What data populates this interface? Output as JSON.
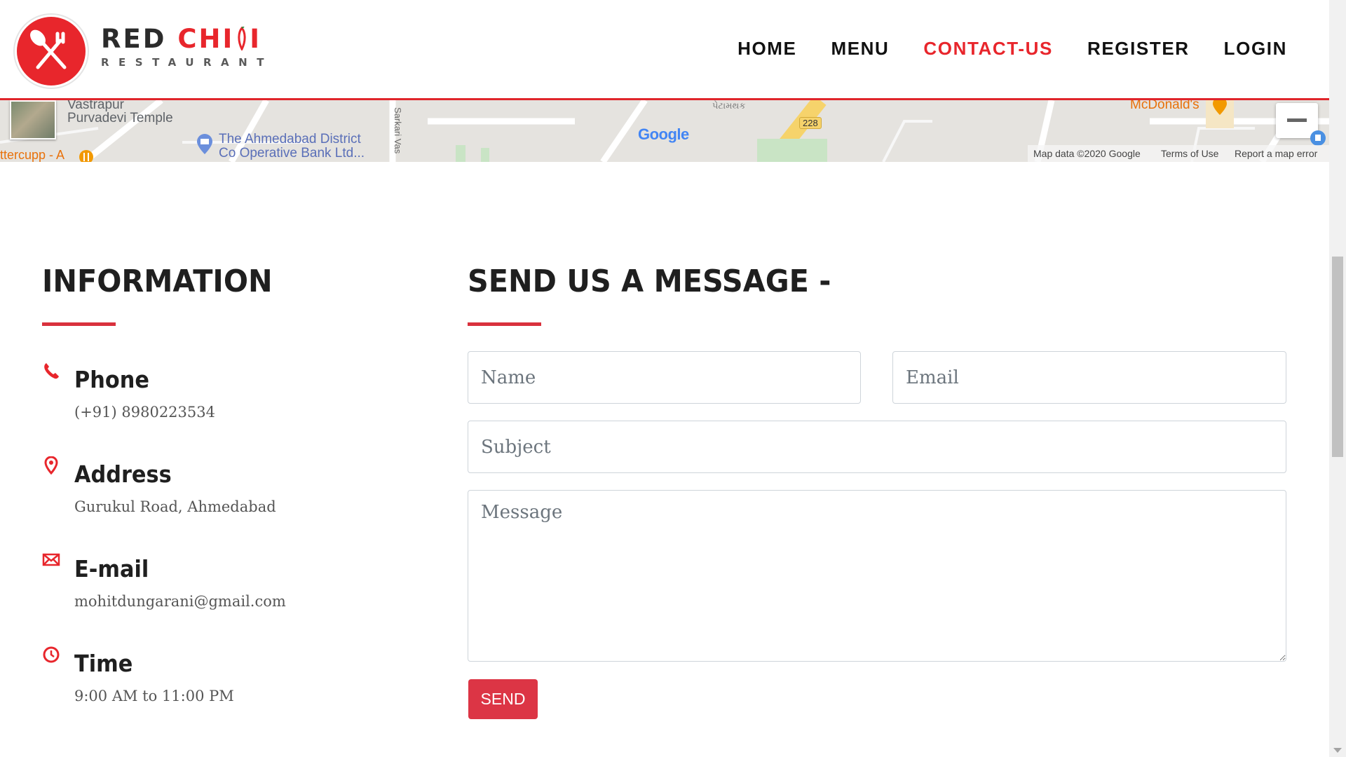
{
  "header": {
    "logo_word1": "RED ",
    "logo_word2": "CHI",
    "logo_word3": "I",
    "logo_sub": "RESTAURANT",
    "nav": [
      "HOME",
      "MENU",
      "CONTACT-US",
      "REGISTER",
      "LOGIN"
    ],
    "active_nav": "CONTACT-US"
  },
  "map": {
    "labels": {
      "vastrapur": "Vastrapur",
      "temple": "Purvadevi Temple",
      "bank_line1": "The Ahmedabad District",
      "bank_line2": "Co Operative Bank Ltd...",
      "buttercupp": "ttercupp - A",
      "mcdonalds": "McDonald's",
      "road_number": "228",
      "sarkari": "Sarkari Vas",
      "gujarati": "પેટામથક",
      "google": "Google"
    },
    "attribution": {
      "map_data": "Map data ©2020 Google",
      "terms": "Terms of Use",
      "report": "Report a map error"
    }
  },
  "information": {
    "title": "INFORMATION",
    "items": [
      {
        "icon": "phone-icon",
        "label": "Phone",
        "value": "(+91) 8980223534"
      },
      {
        "icon": "location-pin-icon",
        "label": "Address",
        "value": "Gurukul Road, Ahmedabad"
      },
      {
        "icon": "envelope-icon",
        "label": "E-mail",
        "value": "mohitdungarani@gmail.com"
      },
      {
        "icon": "clock-icon",
        "label": "Time",
        "value": "9:00 AM to 11:00 PM"
      }
    ]
  },
  "contact_form": {
    "title": "SEND US A MESSAGE -",
    "name_placeholder": "Name",
    "email_placeholder": "Email",
    "subject_placeholder": "Subject",
    "message_placeholder": "Message",
    "send_label": "SEND"
  },
  "colors": {
    "brand_red": "#e8262c",
    "button_red": "#dc3545",
    "rule_red": "#d9313d"
  }
}
